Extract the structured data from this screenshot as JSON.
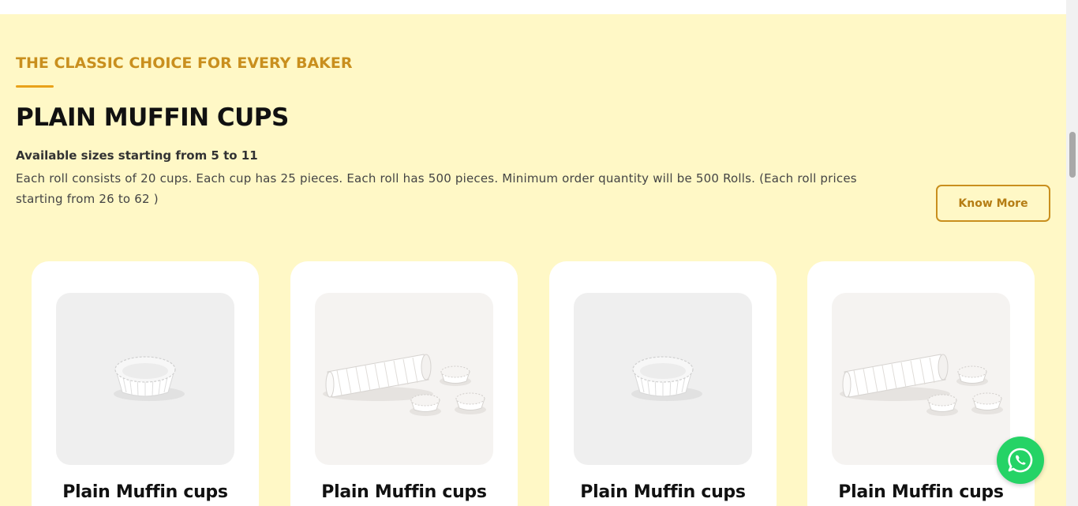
{
  "section": {
    "eyebrow": "THE CLASSIC CHOICE FOR EVERY BAKER",
    "title": "PLAIN MUFFIN CUPS",
    "sizes": "Available sizes starting from 5 to 11",
    "description": "Each roll consists of 20 cups. Each cup has 25 pieces. Each roll has 500 pieces. Minimum order quantity will be 500 Rolls. (Each roll prices starting from 26 to 62 )",
    "know_more_label": "Know More"
  },
  "products": [
    {
      "name": "Plain Muffin cups",
      "image": "single-cup"
    },
    {
      "name": "Plain Muffin cups",
      "image": "cup-roll"
    },
    {
      "name": "Plain Muffin cups",
      "image": "single-cup"
    },
    {
      "name": "Plain Muffin cups",
      "image": "cup-roll"
    }
  ],
  "floating": {
    "icon": "whatsapp-icon"
  },
  "colors": {
    "section_bg": "#fff8c6",
    "accent": "#c98f1e",
    "whatsapp": "#25d366"
  }
}
